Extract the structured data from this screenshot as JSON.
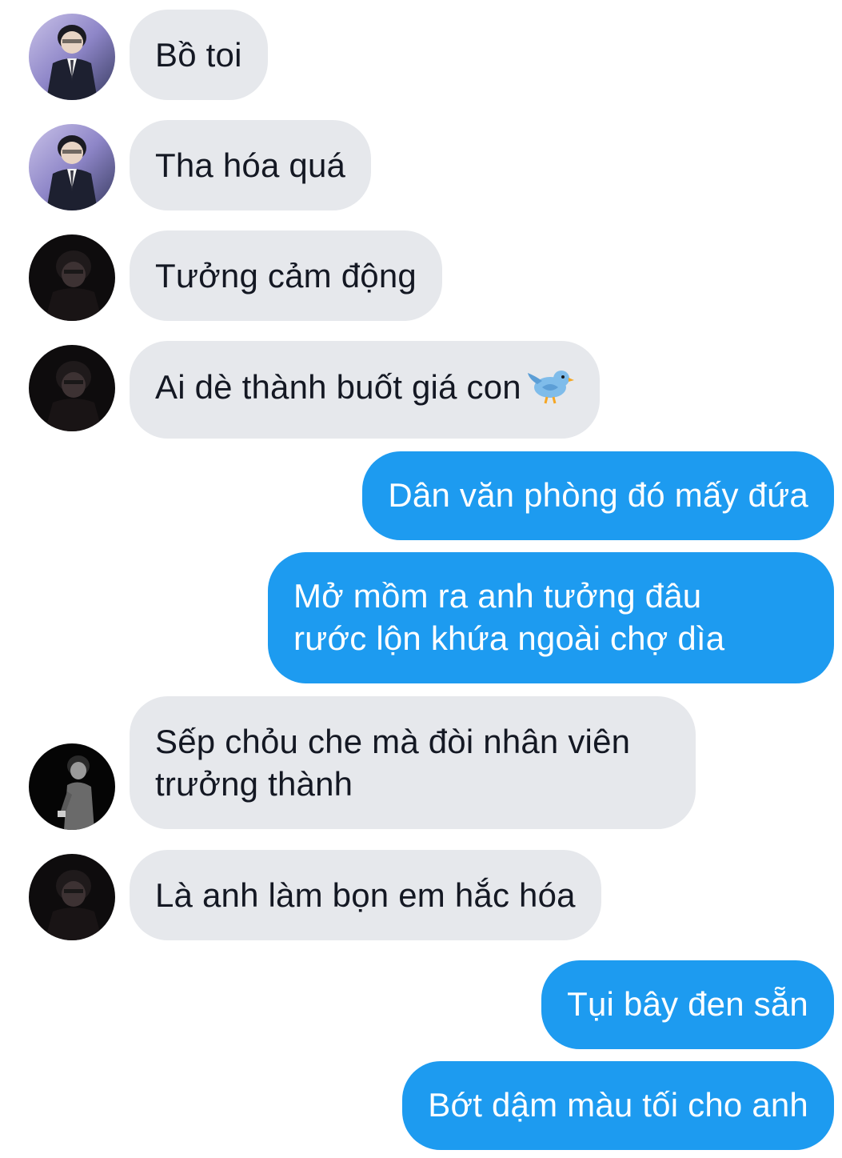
{
  "messages": [
    {
      "side": "in",
      "avatar": "avatar-suit",
      "text": "Bồ toi"
    },
    {
      "side": "in",
      "avatar": "avatar-suit",
      "text": "Tha hóa quá"
    },
    {
      "side": "in",
      "avatar": "avatar-dark",
      "text": "Tưởng cảm động"
    },
    {
      "side": "in",
      "avatar": "avatar-dark",
      "text": "Ai dè thành buốt giá con",
      "emoji": "bird-emoji"
    },
    {
      "side": "out",
      "text": "Dân văn phòng đó mấy đứa"
    },
    {
      "side": "out",
      "line1": "Mở mồm ra anh tưởng đâu",
      "line2": "rước lộn khứa ngoài chợ dìa"
    },
    {
      "side": "in",
      "avatar": "avatar-standing",
      "line1": "Sếp chỏu che mà đòi nhân viên",
      "line2": "trưởng thành"
    },
    {
      "side": "in",
      "avatar": "avatar-dark",
      "text": "Là anh làm bọn em hắc hóa"
    },
    {
      "side": "out",
      "text": "Tụi bây đen sẵn"
    },
    {
      "side": "out",
      "text": "Bớt dậm màu tối cho anh"
    }
  ],
  "colors": {
    "incoming_bubble": "#e6e8ec",
    "outgoing_bubble": "#1d9bf0",
    "incoming_text": "#141823",
    "outgoing_text": "#ffffff"
  }
}
